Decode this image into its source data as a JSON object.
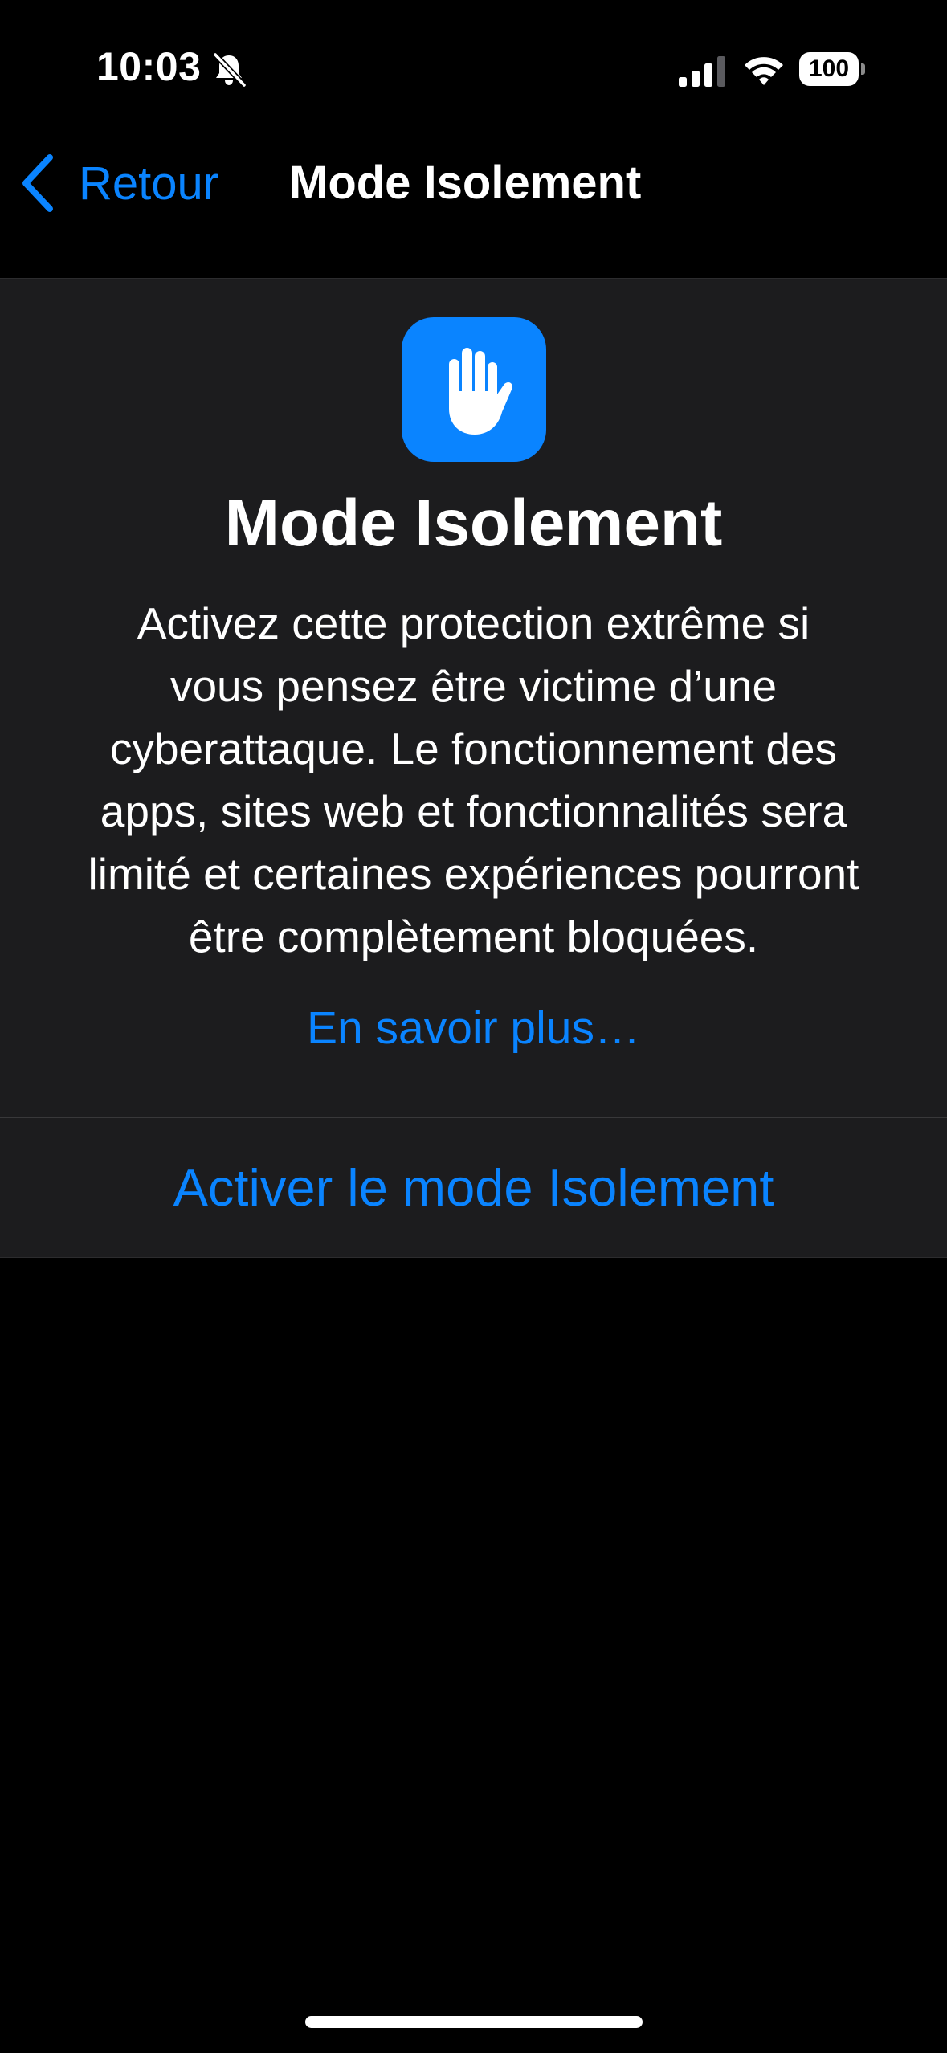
{
  "status_bar": {
    "time": "10:03",
    "battery_level": "100",
    "icons": [
      "bell-slash-icon",
      "cellular-signal-icon",
      "wifi-icon",
      "battery-icon"
    ]
  },
  "nav": {
    "back_label": "Retour",
    "title": "Mode Isolement"
  },
  "content": {
    "icon": "raised-hand-icon",
    "title": "Mode Isolement",
    "description_lines": [
      "Activez cette protection extrême si",
      "vous pensez être victime d’une",
      "cyberattaque. Le fonctionnement des",
      "apps, sites web et fonctionnalités sera",
      "limité et certaines expériences pourront",
      "être complètement bloquées."
    ],
    "learn_more_label": "En savoir plus…",
    "action_label": "Activer le mode Isolement"
  },
  "colors": {
    "accent": "#0a84ff",
    "background": "#000000",
    "card_background": "#1c1c1e",
    "text": "#ffffff"
  }
}
